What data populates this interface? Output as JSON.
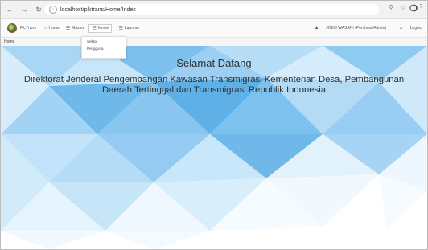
{
  "browser": {
    "back_icon": "back-arrow-icon",
    "forward_icon": "forward-arrow-icon",
    "reload_icon": "reload-icon",
    "url": "localhost/piktrans/Home/Index",
    "zoom_icon": "zoom-icon",
    "star_icon": "star-icon",
    "profile_icon": "profile-icon",
    "menu_icon": "kebab-menu-icon"
  },
  "navbar": {
    "brand": "Pk.Trans",
    "items": [
      {
        "label": "Home",
        "icon": "home-icon"
      },
      {
        "label": "Master",
        "icon": "list-icon"
      },
      {
        "label": "Model",
        "icon": "list-icon"
      },
      {
        "label": "Laporan",
        "icon": "list-icon"
      }
    ],
    "user": "JOKO WASANI (Pembuat/Admin)",
    "logout": "Logout"
  },
  "dropdown": {
    "items": [
      "Sektor",
      "Pengguna"
    ]
  },
  "breadcrumb": {
    "current": "Home"
  },
  "main": {
    "title": "Selamat Datang",
    "subtitle_line1": "Direktorat Jenderal Pengembangan Kawasan Transmigrasi Kementerian Desa, Pembangunan",
    "subtitle_line2": "Daerah Tertinggal dan Transmigrasi Republik Indonesia"
  },
  "colors": {
    "accent": "#4aa3df",
    "background_triangles": [
      "#d6ebfa",
      "#9fd0f2",
      "#6ab6e8",
      "#c5e4f8"
    ]
  }
}
